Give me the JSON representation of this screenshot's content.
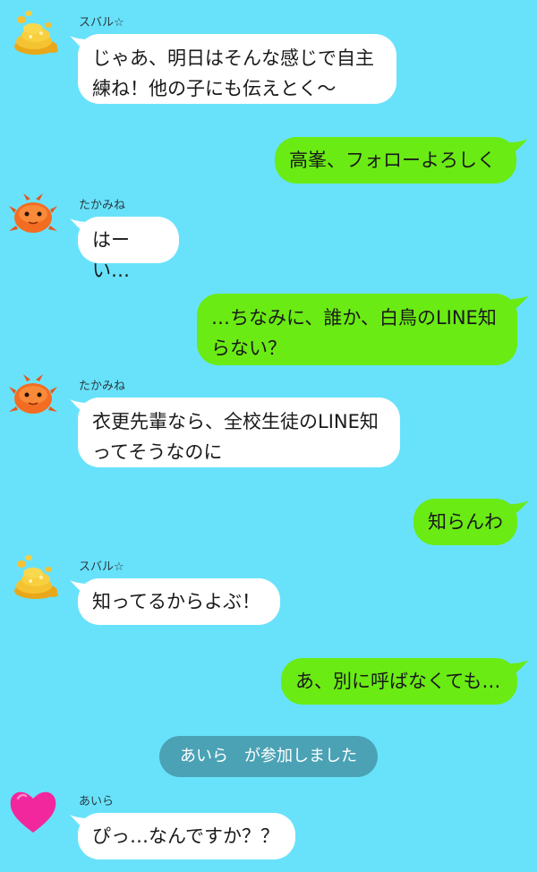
{
  "messages": [
    {
      "type": "incoming",
      "sender": "スバル☆",
      "avatar": "gold-coins-avatar-icon",
      "lines": [
        "じゃあ、明日はそんな感じで自主",
        "練ね！他の子にも伝えとく〜"
      ]
    },
    {
      "type": "outgoing",
      "lines": [
        "高峯、フォローよろしく"
      ]
    },
    {
      "type": "incoming",
      "sender": "たかみね",
      "avatar": "orange-crab-avatar-icon",
      "lines": [
        "はーい…"
      ]
    },
    {
      "type": "outgoing",
      "lines": [
        "…ちなみに、誰か、白鳥のLINE知",
        "らない？"
      ]
    },
    {
      "type": "incoming",
      "sender": "たかみね",
      "avatar": "orange-crab-avatar-icon",
      "lines": [
        "衣更先輩なら、全校生徒のLINE知",
        "ってそうなのに"
      ]
    },
    {
      "type": "outgoing",
      "lines": [
        "知らんわ"
      ]
    },
    {
      "type": "incoming",
      "sender": "スバル☆",
      "avatar": "gold-coins-avatar-icon",
      "lines": [
        "知ってるからよぶ！"
      ]
    },
    {
      "type": "outgoing",
      "lines": [
        "あ、別に呼ばなくても…"
      ]
    },
    {
      "type": "system",
      "text": "あいら　が参加しました"
    },
    {
      "type": "incoming",
      "sender": "あいら",
      "avatar": "pink-heart-avatar-icon",
      "lines": [
        "ぴっ…なんですか？？"
      ]
    }
  ],
  "colors": {
    "background": "#68e2fb",
    "incoming_bubble": "#ffffff",
    "outgoing_bubble": "#6aeb14",
    "system_pill": "#4ba2b5"
  }
}
